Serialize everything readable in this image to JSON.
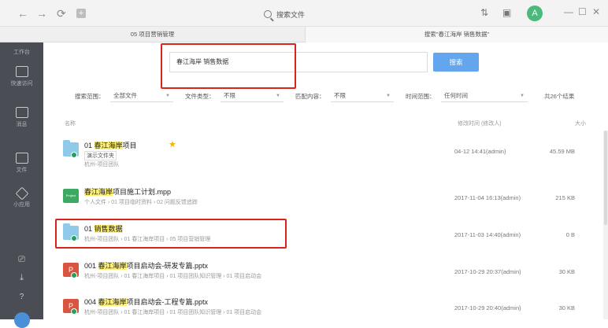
{
  "topbar": {
    "back": "←",
    "forward": "→",
    "refresh": "⟳",
    "add": "+",
    "search_text": "搜索文件",
    "avatar": "A",
    "minimize": "—",
    "maximize": "☐",
    "close": "✕"
  },
  "tabs": [
    "05 项目营销管理",
    "搜索\"春江海岸 销售数据\""
  ],
  "sidebar": {
    "top_label": "工作台",
    "items": [
      "快速访问",
      "消息",
      "文件",
      "小应用"
    ]
  },
  "search": {
    "query": "春江海岸 销售数据",
    "button": "搜索"
  },
  "filters": {
    "scope_label": "搜索范围：",
    "scope_value": "全部文件",
    "type_label": "文件类型：",
    "type_value": "不限",
    "match_label": "匹配内容：",
    "match_value": "不限",
    "time_label": "时间范围：",
    "time_value": "任何时间",
    "count": "共26个结果"
  },
  "columns": {
    "name": "名称",
    "modified": "修改时间 (修改人)",
    "size": "大小"
  },
  "results": [
    {
      "pre": "01 ",
      "hl": "春江海岸",
      "post": "项目",
      "sub": "杭州-项目团队",
      "tag": "演示文件夹",
      "time": "04-12 14:41(admin)",
      "size": "45.59 MB"
    },
    {
      "pre": "",
      "hl": "春江海岸",
      "post": "项目施工计划.mpp",
      "sub": "个人文件 › 01 项目临时资料 › 02 问题反馈追踪",
      "time": "2017-11-04 16:13(admin)",
      "size": "215 KB"
    },
    {
      "pre": "01 ",
      "hl": "销售数据",
      "post": "",
      "sub": "杭州-项目团队 › 01 春江海岸项目 › 05 项目营销管理",
      "time": "2017-11-03 14:40(admin)",
      "size": "0 B"
    },
    {
      "pre": "001 ",
      "hl": "春江海岸",
      "post": "项目启动会-研发专篇.pptx",
      "sub": "杭州-项目团队 › 01 春江海岸项目 › 01 项目团队知识管理 › 01 项目启动会",
      "time": "2017-10-29 20:37(admin)",
      "size": "30 KB"
    },
    {
      "pre": "004 ",
      "hl": "春江海岸",
      "post": "项目启动会-工程专篇.pptx",
      "sub": "杭州-项目团队 › 01 春江海岸项目 › 01 项目团队知识管理 › 01 项目启动会",
      "time": "2017-10-29 20:40(admin)",
      "size": "30 KB"
    }
  ],
  "colors": {
    "accent": "#63a6ee",
    "highlight": "#fff176",
    "annotation": "#d9241c",
    "sidebar": "#4a4d53"
  }
}
